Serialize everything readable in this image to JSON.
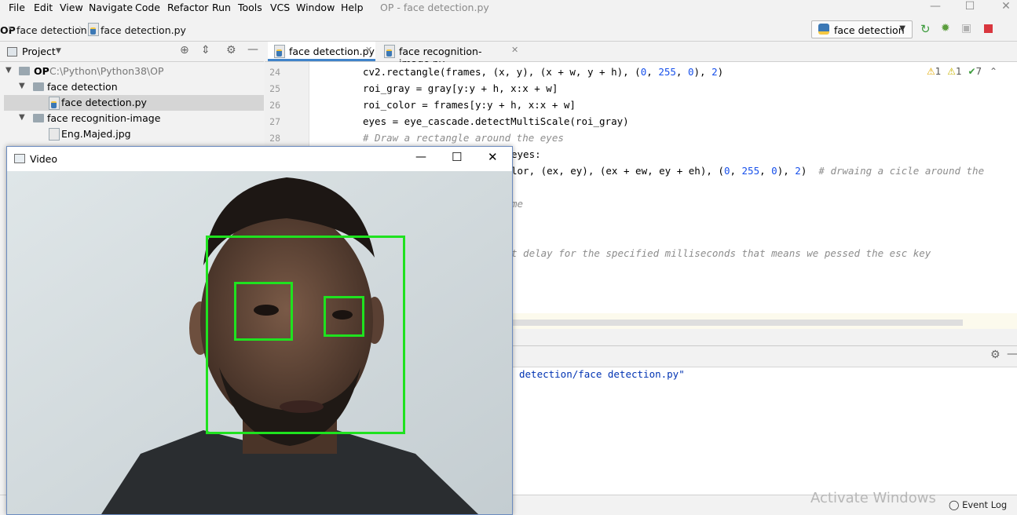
{
  "menu": {
    "items": [
      "File",
      "Edit",
      "View",
      "Navigate",
      "Code",
      "Refactor",
      "Run",
      "Tools",
      "VCS",
      "Window",
      "Help"
    ],
    "window_title": "OP - face detection.py"
  },
  "navbar": {
    "crumbs": [
      "OP",
      "face detection",
      "face detection.py"
    ],
    "run_config": "face detection"
  },
  "project": {
    "header": "Project",
    "tree": [
      {
        "label": "OP",
        "path": "C:\\Python\\Python38\\OP"
      },
      {
        "label": "face detection"
      },
      {
        "label": "face detection.py"
      },
      {
        "label": "face recognition-image"
      },
      {
        "label": "Eng.Majed.jpg"
      }
    ]
  },
  "editor": {
    "tabs": [
      "face detection.py",
      "face recognition-image.py"
    ],
    "line_numbers": [
      "24",
      "25",
      "26",
      "27",
      "28"
    ],
    "lines": [
      {
        "pre": "cv2.rectangle(frames, (x, y), (x + w, y + h), (",
        "n1": "0",
        "s1": ", ",
        "n2": "255",
        "s2": ", ",
        "n3": "0",
        "s3": "), ",
        "n4": "2",
        "post": ")"
      },
      {
        "text": "roi_gray = gray[y:y + h, x:x + w]"
      },
      {
        "text": "roi_color = frames[y:y + h, x:x + w]"
      },
      {
        "text": "eyes = eye_cascade.detectMultiScale(roi_gray)"
      },
      {
        "comment": "# Draw a rectangle around the eyes"
      },
      {
        "text": "eyes:"
      },
      {
        "pre": "lor, (ex, ey), (ex + ew, ey + eh), (",
        "n1": "0",
        "s1": ", ",
        "n2": "255",
        "s2": ", ",
        "n3": "0",
        "s3": "), ",
        "n4": "2",
        "post": ")  ",
        "comment": "# drwaing a cicle around the"
      },
      {
        "comment": "me"
      },
      {
        "comment": "t delay for the specified milliseconds that means we pessed the esc key"
      }
    ],
    "inspections": {
      "warn": "1",
      "weak": "1",
      "typo": "7"
    }
  },
  "run": {
    "console": "detection/face detection.py\""
  },
  "status": {
    "activate": "Activate Windows",
    "event_log": "Event Log"
  },
  "video": {
    "title": "Video"
  },
  "colors": {
    "detection_box": "#1fe21f",
    "active_tab_underline": "#4083c9",
    "number_literal": "#1750eb"
  }
}
